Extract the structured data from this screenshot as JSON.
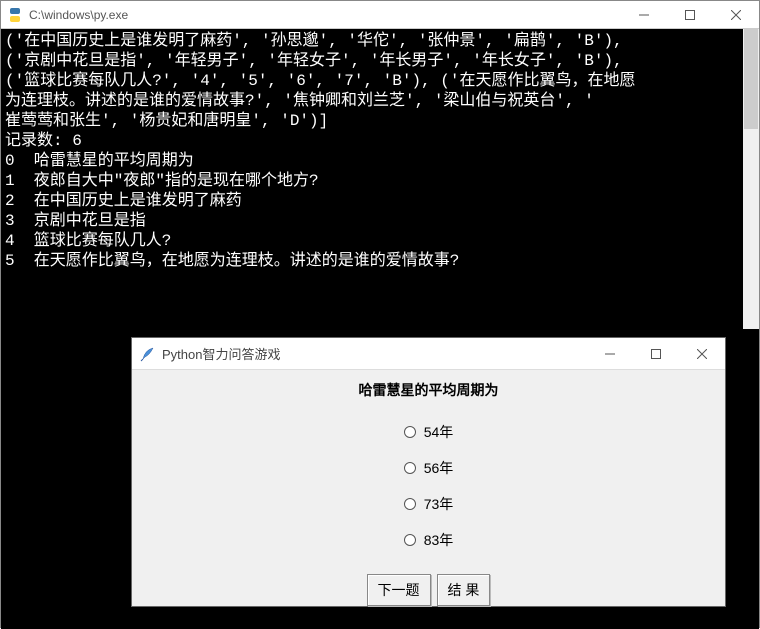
{
  "console": {
    "title": "C:\\windows\\py.exe",
    "lines": [
      "('在中国历史上是谁发明了麻药', '孙思邈', '华佗', '张仲景', '扁鹊', 'B'),",
      "('京剧中花旦是指', '年轻男子', '年轻女子', '年长男子', '年长女子', 'B'),",
      "('篮球比赛每队几人?', '4', '5', '6', '7', 'B'), ('在天愿作比翼鸟，在地愿",
      "为连理枝。讲述的是谁的爱情故事?', '焦钟卿和刘兰芝', '梁山伯与祝英台', '",
      "崔莺莺和张生', '杨贵妃和唐明皇', 'D')]",
      "记录数: 6",
      "0  哈雷慧星的平均周期为",
      "1  夜郎自大中\"夜郎\"指的是现在哪个地方?",
      "2  在中国历史上是谁发明了麻药",
      "3  京剧中花旦是指",
      "4  篮球比赛每队几人?",
      "5  在天愿作比翼鸟，在地愿为连理枝。讲述的是谁的爱情故事?"
    ]
  },
  "dialog": {
    "title": "Python智力问答游戏",
    "question": "哈雷慧星的平均周期为",
    "options": [
      "54年",
      "56年",
      "73年",
      "83年"
    ],
    "next_btn": "下一题",
    "result_btn": "结  果"
  }
}
